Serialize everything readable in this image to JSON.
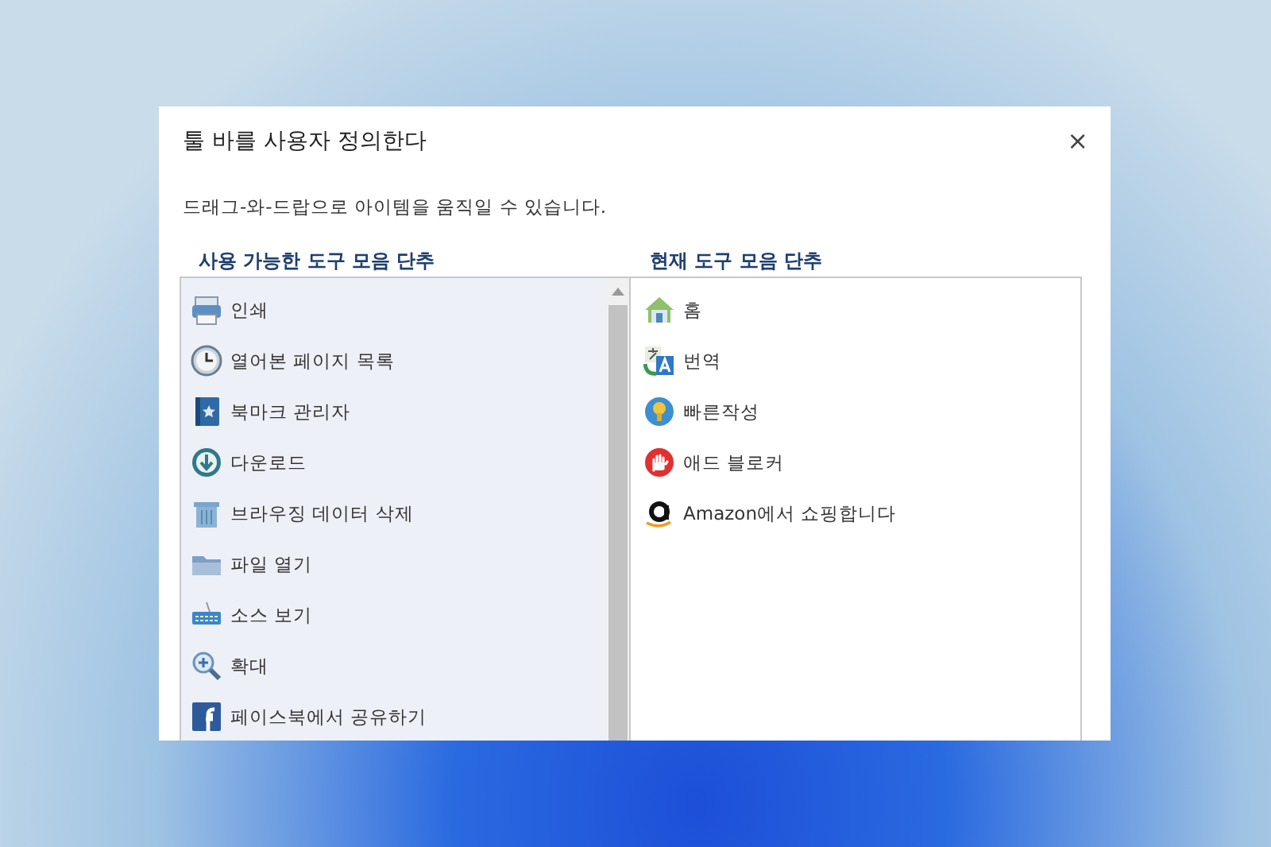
{
  "dialog": {
    "title": "툴 바를 사용자 정의한다",
    "close": "×",
    "instruction": "드래그-와-드랍으로 아이템을 움직일 수 있습니다."
  },
  "available": {
    "heading": "사용 가능한 도구 모음 단추",
    "items": [
      {
        "label": "인쇄"
      },
      {
        "label": "열어본 페이지 목록"
      },
      {
        "label": "북마크 관리자"
      },
      {
        "label": "다운로드"
      },
      {
        "label": "브라우징 데이터 삭제"
      },
      {
        "label": "파일 열기"
      },
      {
        "label": "소스 보기"
      },
      {
        "label": "확대"
      },
      {
        "label": "페이스북에서 공유하기"
      }
    ]
  },
  "current": {
    "heading": "현재 도구 모음 단추",
    "items": [
      {
        "label": "홈"
      },
      {
        "label": "번역"
      },
      {
        "label": "빠른작성"
      },
      {
        "label": "애드 블로커"
      },
      {
        "label": "Amazon에서 쇼핑합니다"
      }
    ]
  }
}
